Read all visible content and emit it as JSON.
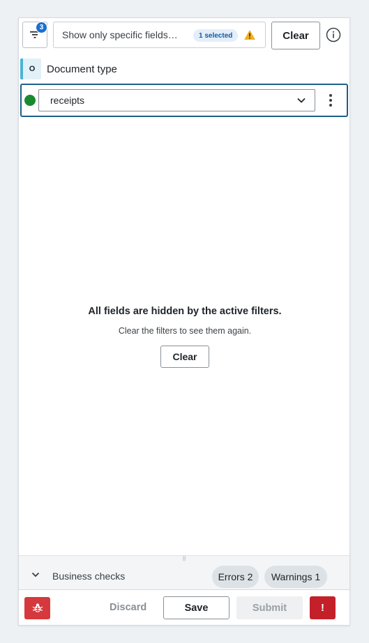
{
  "header": {
    "filter_count": "3",
    "filter_text": "Show only specific fields…",
    "selected_badge": "1 selected",
    "clear_label": "Clear"
  },
  "document_type": {
    "badge": "O",
    "label": "Document type",
    "value": "receipts"
  },
  "empty_state": {
    "title": "All fields are hidden by the active filters.",
    "subtitle": "Clear the filters to see them again.",
    "clear_label": "Clear"
  },
  "business_checks": {
    "label": "Business checks",
    "errors": "Errors 2",
    "warnings": "Warnings 1"
  },
  "footer": {
    "discard": "Discard",
    "save": "Save",
    "submit": "Submit",
    "alert": "!"
  },
  "colors": {
    "accent_blue": "#1a6fd1",
    "status_ok": "#1a8a2f",
    "danger": "#c3202a",
    "warning": "#f2b01e"
  },
  "icons": [
    "filter-icon",
    "warning-icon",
    "info-icon",
    "chevron-down-icon",
    "kebab-menu-icon",
    "bug-icon",
    "chevron-collapse-icon"
  ]
}
